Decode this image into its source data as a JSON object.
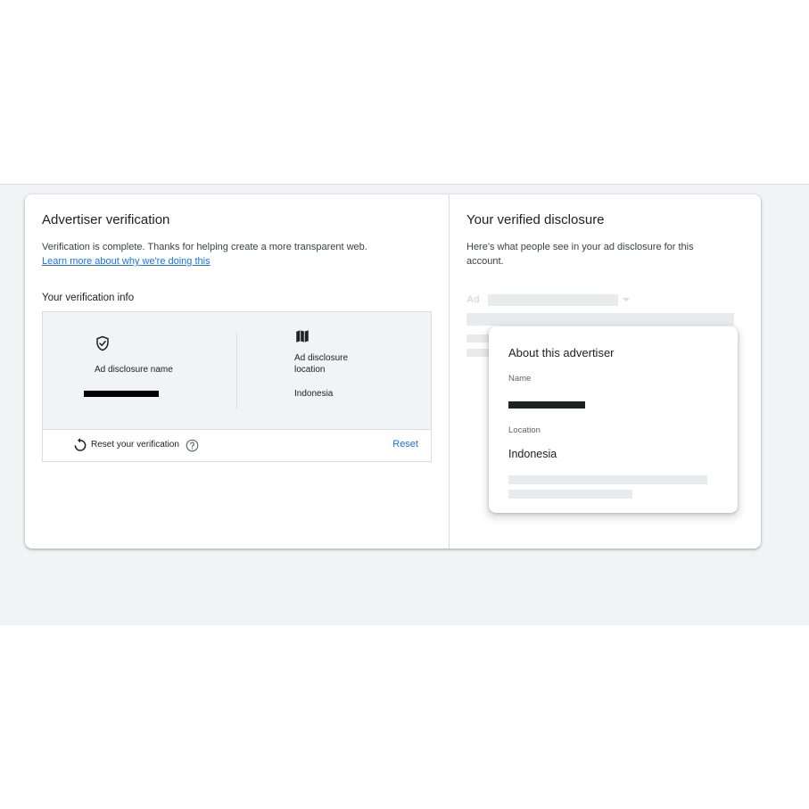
{
  "left_panel": {
    "title": "Advertiser verification",
    "description": "Verification is complete. Thanks for helping create a more transparent web.",
    "learn_more_link": "Learn more about why we're doing this",
    "info_heading": "Your verification info",
    "name_label": "Ad disclosure name",
    "location_label": "Ad disclosure location",
    "location_value": "Indonesia",
    "reset_text": "Reset your verification",
    "reset_button": "Reset"
  },
  "right_panel": {
    "title": "Your verified disclosure",
    "description": "Here's what people see in your ad disclosure for this account.",
    "ad_label": "Ad",
    "popup": {
      "title": "About this advertiser",
      "name_label": "Name",
      "location_label": "Location",
      "location_value": "Indonesia"
    }
  },
  "colors": {
    "accent": "#1a73e8",
    "background": "#f1f3f4",
    "skeleton": "#e8eaed"
  },
  "icons": [
    "shield-check-icon",
    "map-icon",
    "reset-icon",
    "help-icon",
    "dropdown-arrow-icon"
  ]
}
